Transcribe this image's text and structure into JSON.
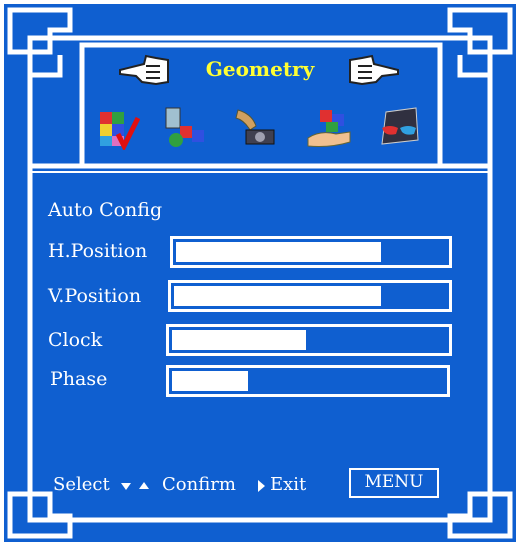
{
  "colors": {
    "background": "#0f5fd0",
    "frame": "#ffffff",
    "title": "#ffff33"
  },
  "header": {
    "title": "Geometry",
    "left_pointer_icon": "hand-pointing-left-icon",
    "right_pointer_icon": "hand-pointing-right-icon"
  },
  "categories": [
    {
      "icon": "color-cube-icon"
    },
    {
      "icon": "shapes-blocks-icon"
    },
    {
      "icon": "geometry-gramophone-icon",
      "selected": true
    },
    {
      "icon": "hand-holding-cubes-icon"
    },
    {
      "icon": "3d-glasses-icon"
    }
  ],
  "menu": {
    "auto_config": "Auto Config",
    "items": [
      {
        "label": "H.Position",
        "value": 0.76
      },
      {
        "label": "V.Position",
        "value": 0.76
      },
      {
        "label": "Clock",
        "value": 0.49
      },
      {
        "label": "Phase",
        "value": 0.28
      }
    ]
  },
  "footer": {
    "select": "Select",
    "confirm": "Confirm",
    "exit": "Exit",
    "menu_button": "MENU"
  }
}
